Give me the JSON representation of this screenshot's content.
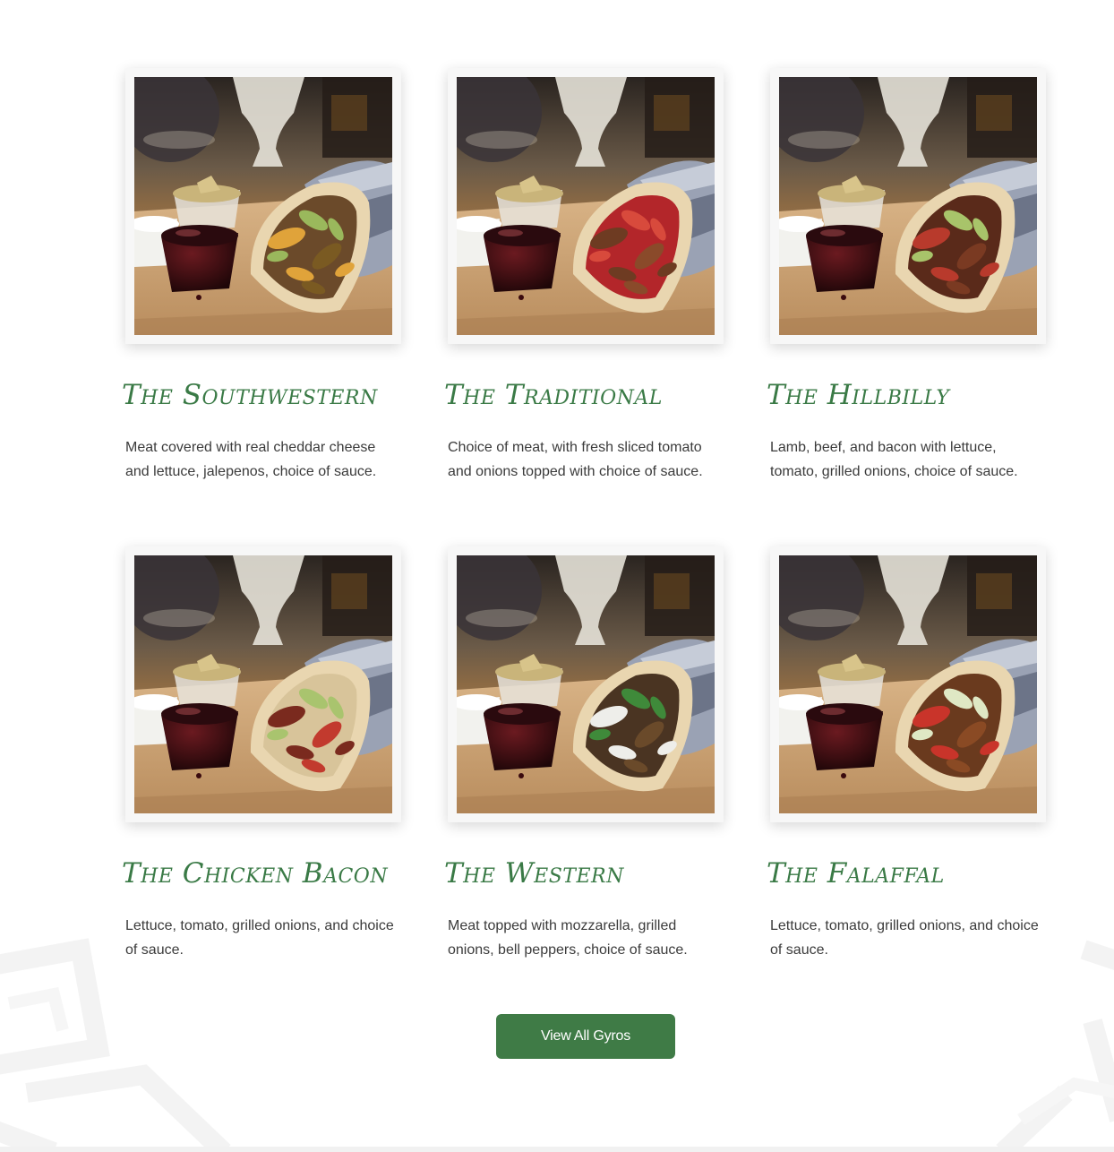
{
  "menu": {
    "items": [
      {
        "title": "The Southwestern",
        "description": "Meat covered with real cheddar cheese and lettuce, jalepenos, choice of sauce.",
        "image": "gyro-southwestern-photo",
        "filling_colors": [
          "#6b4a2a",
          "#e0a33a",
          "#9ab85c",
          "#7a5a22"
        ]
      },
      {
        "title": "The Traditional",
        "description": "Choice of meat, with fresh sliced tomato and onions topped with choice of sauce.",
        "image": "gyro-traditional-photo",
        "filling_colors": [
          "#b3262a",
          "#6e3b22",
          "#d84a3c",
          "#8a4a2a"
        ]
      },
      {
        "title": "The Hillbilly",
        "description": "Lamb, beef, and bacon with lettuce, tomato, grilled onions, choice of sauce.",
        "image": "gyro-hillbilly-photo",
        "filling_colors": [
          "#5a2a1a",
          "#b83a2c",
          "#a8c46a",
          "#7a3a22"
        ]
      },
      {
        "title": "The Chicken Bacon",
        "description": "Lettuce, tomato, grilled onions, and choice of sauce.",
        "image": "gyro-chicken-bacon-photo",
        "filling_colors": [
          "#d8c49a",
          "#7a2a1e",
          "#a9c46e",
          "#c23a2e"
        ]
      },
      {
        "title": "The Western",
        "description": "Meat topped with mozzarella, grilled onions, bell peppers, choice of sauce.",
        "image": "gyro-western-photo",
        "filling_colors": [
          "#4a3422",
          "#eeeeea",
          "#3f8a3a",
          "#6a4a2a"
        ]
      },
      {
        "title": "The Falaffal",
        "description": "Lettuce, tomato, grilled onions, and choice of sauce.",
        "image": "gyro-falaffal-photo",
        "filling_colors": [
          "#6a3a1e",
          "#c9342a",
          "#dfe8c4",
          "#8a4a24"
        ]
      }
    ]
  },
  "cta": {
    "label": "View All Gyros"
  },
  "theme": {
    "accent": "#3f7b46",
    "title_color": "#3a7a46",
    "text_color": "#3b3b3b"
  }
}
